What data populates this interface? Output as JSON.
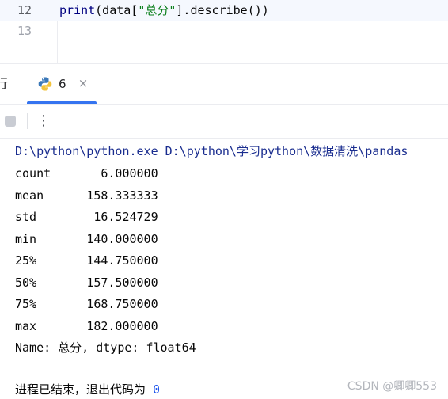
{
  "editor": {
    "lines": [
      {
        "number": "12",
        "code_func": "print",
        "code_before": "(data[",
        "code_string": "\"总分\"",
        "code_after": "].describe())"
      },
      {
        "number": "13",
        "code_func": "",
        "code_before": "",
        "code_string": "",
        "code_after": ""
      }
    ]
  },
  "tool_window": {
    "left_label": "行",
    "run_tab": {
      "label": "6",
      "close": "×",
      "icon": "python-icon"
    }
  },
  "console_toolbar": {
    "stop_icon": "stop-icon",
    "more_icon": "more-vertical-icon",
    "more_glyph": "⋮"
  },
  "console": {
    "command": "D:\\python\\python.exe D:\\python\\学习python\\数据清洗\\pandas",
    "stats": [
      {
        "label": "count",
        "value": "6.000000"
      },
      {
        "label": "mean",
        "value": "158.333333"
      },
      {
        "label": "std",
        "value": "16.524729"
      },
      {
        "label": "min",
        "value": "140.000000"
      },
      {
        "label": "25%",
        "value": "144.750000"
      },
      {
        "label": "50%",
        "value": "157.500000"
      },
      {
        "label": "75%",
        "value": "168.750000"
      },
      {
        "label": "max",
        "value": "182.000000"
      }
    ],
    "name_line": "Name: 总分, dtype: float64",
    "exit_text": "进程已结束，退出代码为 ",
    "exit_code": "0"
  },
  "watermark": "CSDN @卿卿553",
  "colors": {
    "accent": "#3574f0",
    "string": "#067d17",
    "command": "#1a2d8f"
  }
}
